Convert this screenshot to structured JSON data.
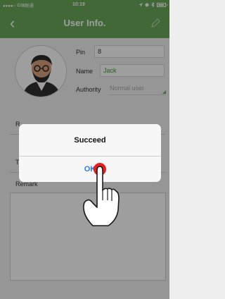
{
  "status_bar": {
    "carrier": "●●●●○ 中国联通",
    "time": "10:19"
  },
  "nav": {
    "back": "‹",
    "title": "User Info."
  },
  "form": {
    "pin_label": "Pin",
    "pin_value": "8",
    "name_label": "Name",
    "name_value": "Jack",
    "authority_label": "Authority",
    "authority_value": "Normal user",
    "row1_label": "R",
    "row2_label": "T",
    "remark_label": "Remark"
  },
  "dialog": {
    "message": "Succeed",
    "ok_label": "OK"
  },
  "colors": {
    "header": "#6aa957",
    "name_text": "#3a9a2c",
    "link": "#2a7ae2",
    "touch_dot": "#e02020"
  },
  "icons": [
    "signal-icon",
    "location-icon",
    "alarm-icon",
    "bluetooth-icon",
    "battery-icon",
    "back-icon",
    "edit-icon",
    "hand-pointer-icon"
  ]
}
